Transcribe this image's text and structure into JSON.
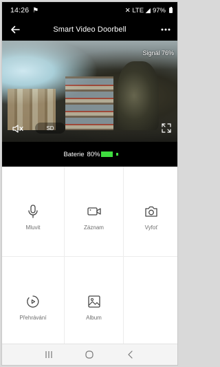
{
  "status_bar": {
    "time": "14:26",
    "notification_icon": "flag-icon",
    "indicators": "✕ LTE ◢",
    "battery": "97%"
  },
  "header": {
    "title": "Smart Video Doorbell",
    "back_icon": "arrow-left-icon",
    "more_icon": "more-dots-icon"
  },
  "video": {
    "signal_text": "Signál 76%",
    "sd_label": "SD",
    "mute_icon": "speaker-mute-icon",
    "fullscreen_icon": "fullscreen-icon"
  },
  "battery": {
    "label": "Baterie",
    "percent_text": "80%",
    "level": 0.8,
    "color": "#3fdc3f"
  },
  "actions": [
    {
      "label": "Mluvit",
      "icon": "microphone-icon"
    },
    {
      "label": "Záznam",
      "icon": "video-camera-icon"
    },
    {
      "label": "Vyfoť",
      "icon": "camera-icon"
    },
    {
      "label": "Přehrávání",
      "icon": "playback-icon"
    },
    {
      "label": "Album",
      "icon": "image-icon"
    }
  ],
  "navigation": {
    "recents_icon": "recents-icon",
    "home_icon": "home-icon",
    "back_icon": "back-chevron-icon"
  }
}
